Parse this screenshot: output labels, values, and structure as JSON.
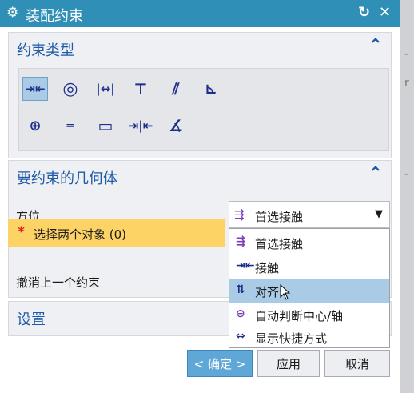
{
  "window": {
    "title": "装配约束",
    "gear_icon": "gear-icon",
    "reset_icon": "reset-icon",
    "close_icon": "close-icon"
  },
  "background": {
    "side_chars": [
      "-",
      "r",
      "-"
    ]
  },
  "constraint_type": {
    "title": "约束类型",
    "tools": [
      {
        "name": "touch-align",
        "glyph": "⇥⇤",
        "selected": true
      },
      {
        "name": "concentric",
        "glyph": "◎"
      },
      {
        "name": "distance",
        "glyph": "|↔|"
      },
      {
        "name": "fix",
        "glyph": "⊤"
      },
      {
        "name": "parallel",
        "glyph": "⫽"
      },
      {
        "name": "perpendicular",
        "glyph": "⊾"
      },
      {
        "name": "align-lock",
        "glyph": "⊕"
      },
      {
        "name": "bond",
        "glyph": "═"
      },
      {
        "name": "fit",
        "glyph": "▭"
      },
      {
        "name": "center",
        "glyph": "⇥|⇤"
      },
      {
        "name": "angle",
        "glyph": "∡"
      }
    ]
  },
  "geometry": {
    "title": "要约束的几何体",
    "orientation_label": "方位",
    "orientation_value": "首选接触",
    "select_label": "选择两个对象 (0)",
    "undo_label": "撤消上一个约束"
  },
  "dropdown": {
    "items": [
      {
        "label": "首选接触",
        "icon": "prefer-touch-icon",
        "highlighted": false
      },
      {
        "label": "接触",
        "icon": "touch-icon",
        "highlighted": false
      },
      {
        "label": "对齐",
        "icon": "align-icon",
        "highlighted": true
      },
      {
        "label": "自动判断中心/轴",
        "icon": "infer-center-axis-icon",
        "highlighted": false
      },
      {
        "label": "显示快捷方式",
        "icon": "show-shortcuts-icon",
        "highlighted": false
      }
    ]
  },
  "settings": {
    "title": "设置"
  },
  "buttons": {
    "ok": "< 确定 >",
    "apply": "应用",
    "cancel": "取消"
  }
}
